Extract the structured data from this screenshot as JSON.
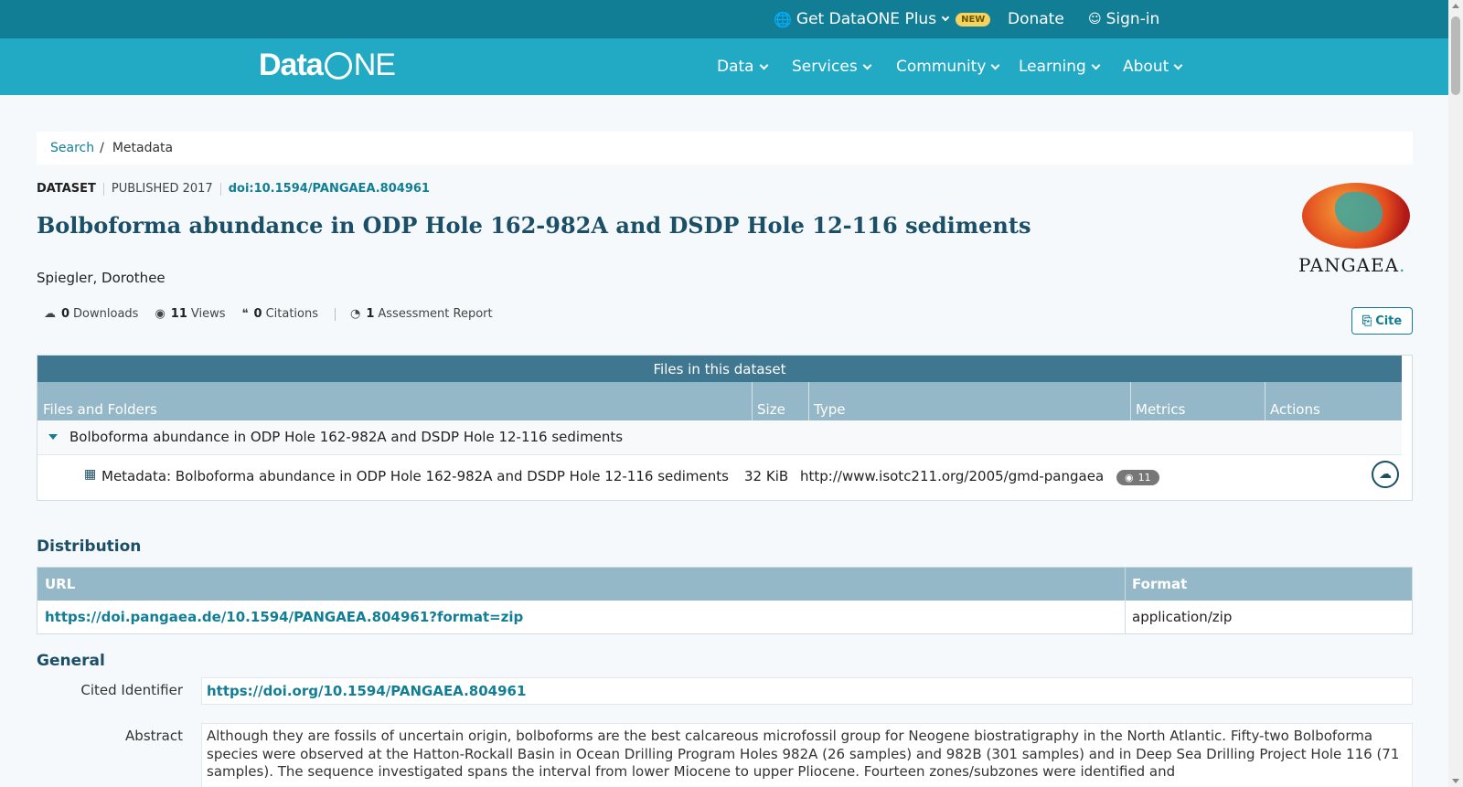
{
  "topbar": {
    "plus_label": "Get DataONE Plus",
    "new_badge": "NEW",
    "donate": "Donate",
    "signin": "Sign-in"
  },
  "nav": {
    "logo_data": "Data",
    "logo_ne": "NE",
    "menu": [
      "Data",
      "Services",
      "Community",
      "Learning",
      "About"
    ]
  },
  "breadcrumb": {
    "search": "Search",
    "sep": "/",
    "current": "Metadata"
  },
  "dataset": {
    "kind": "DATASET",
    "published": "PUBLISHED 2017",
    "doi": "doi:10.1594/PANGAEA.804961",
    "title": "Bolboforma abundance in ODP Hole 162-982A and DSDP Hole 12-116 sediments",
    "author": "Spiegler, Dorothee",
    "repo_logo": "PANGAEA",
    "repo_logo_dot": "."
  },
  "metrics": {
    "downloads_count": "0",
    "downloads_label": "Downloads",
    "views_count": "11",
    "views_label": "Views",
    "citations_count": "0",
    "citations_label": "Citations",
    "assessment_count": "1",
    "assessment_label": "Assessment Report",
    "cite_label": "Cite"
  },
  "files": {
    "heading": "Files in this dataset",
    "columns": [
      "Files and Folders",
      "Size",
      "Type",
      "Metrics",
      "Actions"
    ],
    "folder": "Bolboforma abundance in ODP Hole 162-982A and DSDP Hole 12-116 sediments",
    "file": {
      "name": "Metadata: Bolboforma abundance in ODP Hole 162-982A and DSDP Hole 12-116 sediments",
      "size": "32 KiB",
      "type": "http://www.isotc211.org/2005/gmd-pangaea",
      "views": "11"
    }
  },
  "distribution": {
    "heading": "Distribution",
    "col_url": "URL",
    "col_format": "Format",
    "url": "https://doi.pangaea.de/10.1594/PANGAEA.804961?format=zip",
    "format": "application/zip"
  },
  "general": {
    "heading": "General",
    "cited_label": "Cited Identifier",
    "cited_value": "https://doi.org/10.1594/PANGAEA.804961",
    "abstract_label": "Abstract",
    "abstract_text": "Although they are fossils of uncertain origin, bolboforms are the best calcareous microfossil group for Neogene biostratigraphy in the North Atlantic. Fifty-two Bolboforma species were observed at the Hatton-Rockall Basin in Ocean Drilling Program Holes 982A (26 samples) and 982B (301 samples) and in Deep Sea Drilling Project Hole 116 (71 samples). The sequence investigated spans the interval from lower Miocene to upper Pliocene. Fourteen zones/subzones were identified and"
  }
}
